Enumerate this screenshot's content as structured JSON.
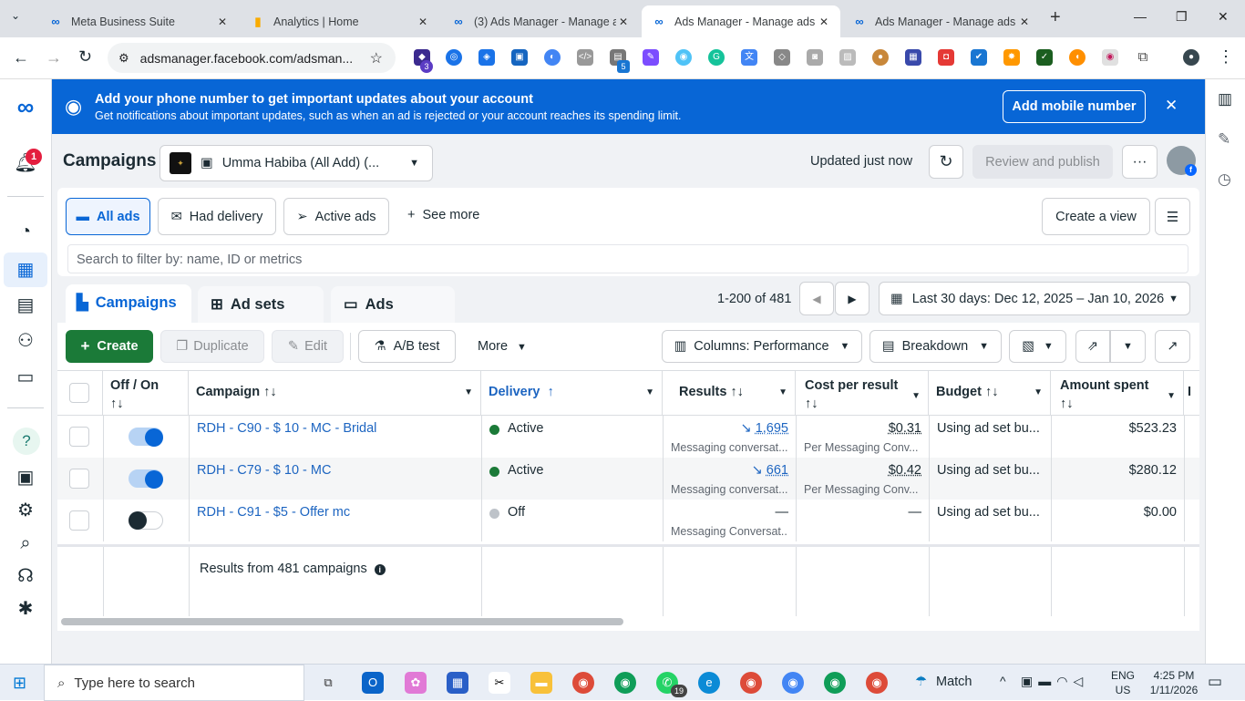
{
  "browser": {
    "tabs": [
      {
        "title": "Meta Business Suite",
        "icon": "meta-icon"
      },
      {
        "title": "Analytics | Home",
        "icon": "analytics-icon"
      },
      {
        "title": "(3) Ads Manager - Manage a",
        "icon": "meta-icon"
      },
      {
        "title": "Ads Manager - Manage ads",
        "icon": "meta-icon",
        "active": true
      },
      {
        "title": "Ads Manager - Manage ads",
        "icon": "meta-icon"
      }
    ],
    "url": "adsmanager.facebook.com/adsman...",
    "extension_badges": {
      "first": "3",
      "folder": "5"
    }
  },
  "nav": {
    "notification_count": "1"
  },
  "banner": {
    "title": "Add your phone number to get important updates about your account",
    "subtitle": "Get notifications about important updates, such as when an ad is rejected or your account reaches its spending limit.",
    "button": "Add mobile number"
  },
  "header": {
    "title": "Campaigns",
    "account": "Umma Habiba (All Add) (...",
    "updated": "Updated just now",
    "review_publish": "Review and publish"
  },
  "views": {
    "all_ads": "All ads",
    "had_delivery": "Had delivery",
    "active_ads": "Active ads",
    "see_more": "See more",
    "create_view": "Create a view"
  },
  "search": {
    "placeholder": "Search to filter by: name, ID or metrics"
  },
  "level_tabs": {
    "campaigns": "Campaigns",
    "ad_sets": "Ad sets",
    "ads": "Ads"
  },
  "pagination": "1-200 of 481",
  "date_range": "Last 30 days: Dec 12, 2025 – Jan 10, 2026",
  "actions": {
    "create": "Create",
    "duplicate": "Duplicate",
    "edit": "Edit",
    "ab_test": "A/B test",
    "more": "More",
    "columns": "Columns: Performance",
    "breakdown": "Breakdown"
  },
  "table": {
    "headers": {
      "off_on": "Off / On",
      "campaign": "Campaign",
      "delivery": "Delivery",
      "results": "Results",
      "cost_per_result": "Cost per result",
      "budget": "Budget",
      "amount_spent": "Amount spent",
      "sort_glyph": "↑↓",
      "delivery_sort": "↑"
    },
    "rows": [
      {
        "on": true,
        "campaign": "RDH - C90 - $ 10 - MC - Bridal",
        "delivery": "Active",
        "delivery_color": "#1b7a38",
        "results": "1,695",
        "results_sub": "Messaging conversat...",
        "cost": "$0.31",
        "cost_sub": "Per Messaging Conv...",
        "budget": "Using ad set bu...",
        "spent": "$523.23"
      },
      {
        "on": true,
        "campaign": "RDH - C79 - $ 10 - MC",
        "delivery": "Active",
        "delivery_color": "#1b7a38",
        "results": "661",
        "results_sub": "Messaging conversat...",
        "cost": "$0.42",
        "cost_sub": "Per Messaging Conv...",
        "budget": "Using ad set bu...",
        "spent": "$280.12"
      },
      {
        "on": false,
        "campaign": "RDH - C91 - $5 - Offer mc",
        "delivery": "Off",
        "delivery_color": "#bec3c9",
        "results": "—",
        "results_sub": "Messaging Conversat...",
        "cost": "—",
        "cost_sub": "",
        "budget": "Using ad set bu...",
        "spent": "$0.00"
      }
    ],
    "footer": "Results from 481 campaigns"
  },
  "taskbar": {
    "search_placeholder": "Type here to search",
    "whatsapp_badge": "19",
    "weather": "Match",
    "lang": "ENG",
    "region": "US",
    "time": "4:25 PM",
    "date": "1/11/2026"
  },
  "colors": {
    "primary": "#0866d6",
    "create_green": "#1b7a38",
    "link": "#1d65c1"
  }
}
